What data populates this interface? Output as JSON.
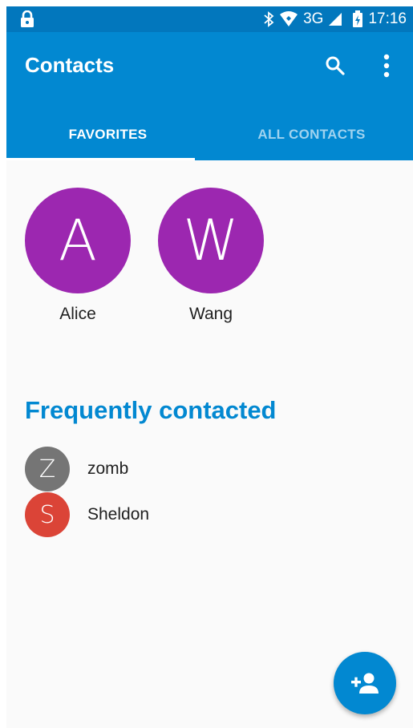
{
  "status_bar": {
    "network": "3G",
    "time": "17:16"
  },
  "app_bar": {
    "title": "Contacts"
  },
  "tabs": [
    {
      "label": "FAVORITES",
      "selected": true
    },
    {
      "label": "ALL CONTACTS",
      "selected": false
    }
  ],
  "favorites": [
    {
      "initial": "A",
      "name": "Alice",
      "color": "#9c27b0"
    },
    {
      "initial": "W",
      "name": "Wang",
      "color": "#9c27b0"
    }
  ],
  "frequent": {
    "title": "Frequently contacted",
    "items": [
      {
        "initial": "Z",
        "name": "zomb",
        "color": "#757575"
      },
      {
        "initial": "S",
        "name": "Sheldon",
        "color": "#db4437"
      }
    ]
  },
  "colors": {
    "status_bar": "#0277bd",
    "primary": "#0288d1",
    "inactive_tab": "#9fd2ef",
    "favorite_avatar": "#9c27b0"
  },
  "icons": [
    "lock-icon",
    "bluetooth-icon",
    "wifi-icon",
    "signal-icon",
    "battery-icon",
    "search-icon",
    "more-vert-icon",
    "add-person-icon"
  ]
}
